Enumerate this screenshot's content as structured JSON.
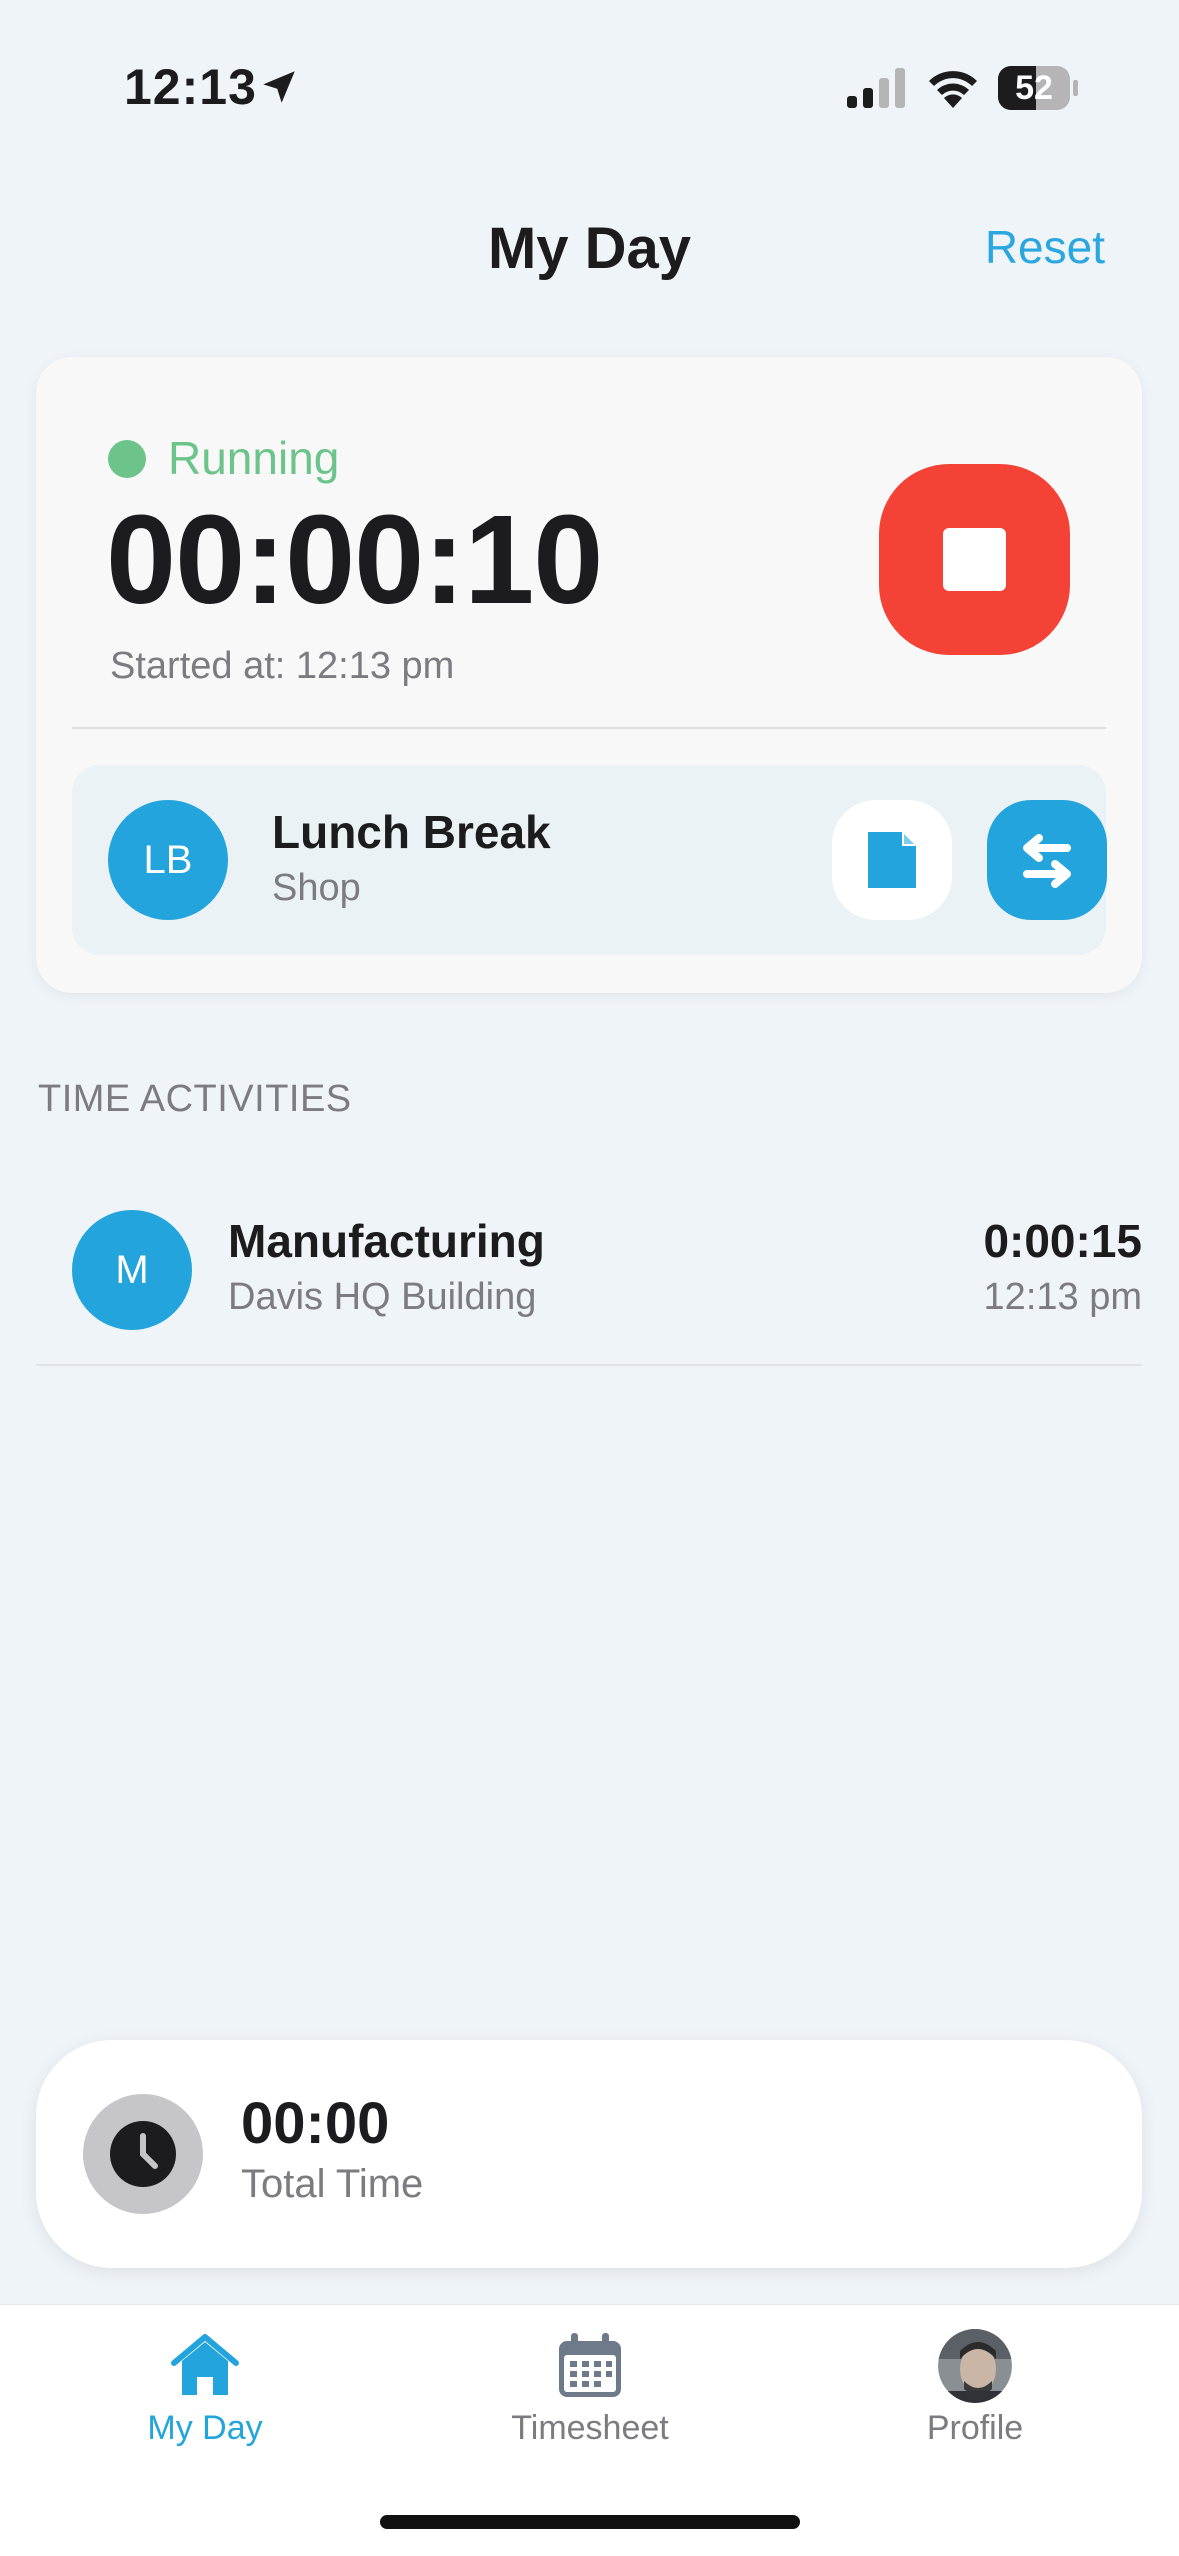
{
  "status_bar": {
    "time": "12:13",
    "battery": "52"
  },
  "header": {
    "title": "My Day",
    "reset_label": "Reset"
  },
  "timer": {
    "status": "Running",
    "elapsed": "00:00:10",
    "started_at": "Started at: 12:13 pm",
    "status_color": "#6cc48b",
    "stop_color": "#f44236"
  },
  "current_job": {
    "initials": "LB",
    "name": "Lunch Break",
    "location": "Shop"
  },
  "activities": {
    "section_title": "TIME ACTIVITIES",
    "items": [
      {
        "initials": "M",
        "name": "Manufacturing",
        "location": "Davis HQ Building",
        "duration": "0:00:15",
        "time": "12:13 pm"
      }
    ]
  },
  "total": {
    "value": "00:00",
    "label": "Total Time"
  },
  "tabs": [
    {
      "label": "My Day",
      "icon": "home-icon",
      "active": true
    },
    {
      "label": "Timesheet",
      "icon": "calendar-icon",
      "active": false
    },
    {
      "label": "Profile",
      "icon": "profile-photo",
      "active": false
    }
  ],
  "accent_color": "#23a4dc"
}
